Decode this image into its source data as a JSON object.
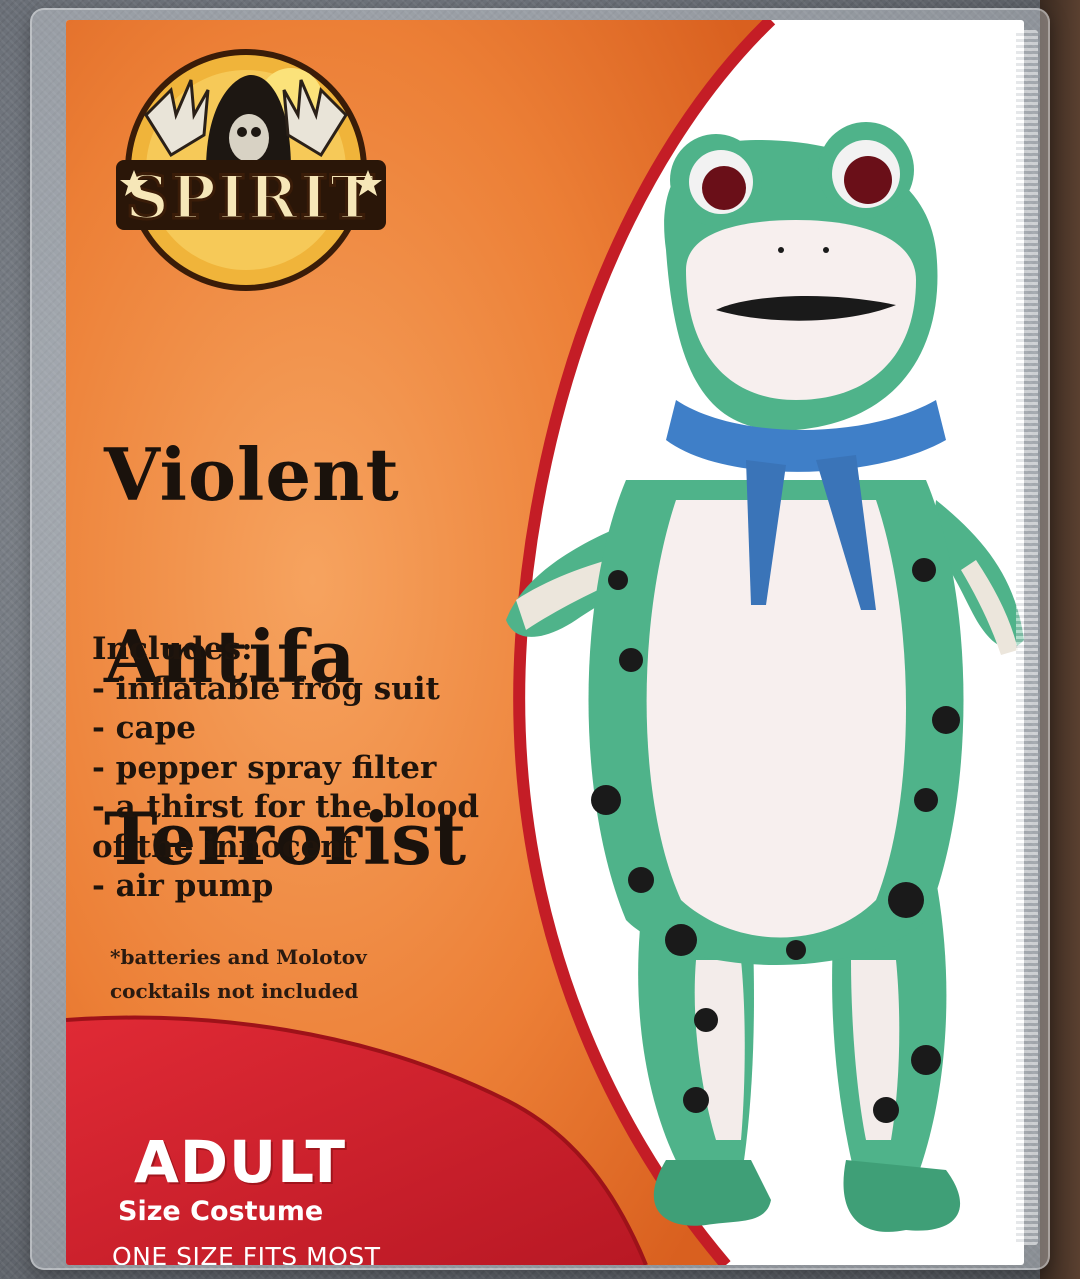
{
  "brand": {
    "logo_text": "SPIRIT"
  },
  "product": {
    "title_lines": [
      "Violent",
      "Antifa",
      "Terrorist"
    ],
    "includes_heading": "Includes:",
    "includes_items": [
      "- inflatable frog suit",
      "- cape",
      "- pepper spray filter",
      "- a thirst for the blood",
      "of the innocent",
      "- air pump"
    ],
    "footnote_lines": [
      "*batteries and Molotov",
      "cocktails not included"
    ],
    "size_label": "ADULT",
    "size_sub": "Size Costume",
    "fit_label": "ONE SIZE FITS MOST"
  },
  "colors": {
    "orange": "#e8762e",
    "orange_light": "#f4a060",
    "red_band": "#d8232f",
    "dark_red": "#a01820",
    "frog_green": "#4fb38a",
    "frog_belly": "#f7efee",
    "scarf_blue": "#3f7fc8"
  }
}
